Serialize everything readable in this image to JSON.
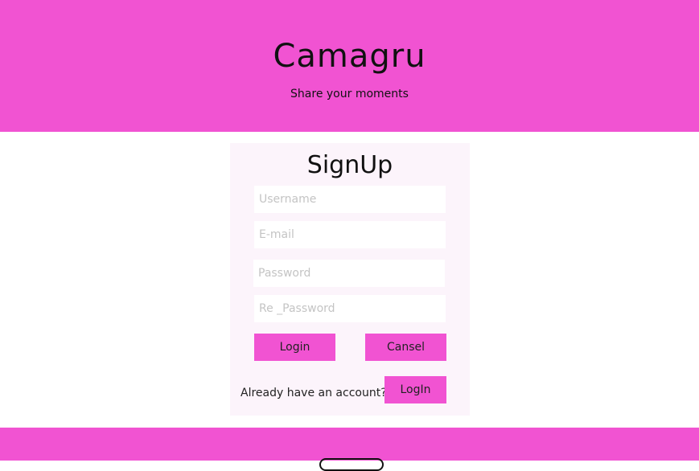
{
  "header": {
    "title": "Camagru",
    "tagline": "Share your moments"
  },
  "signup": {
    "heading": "SignUp",
    "username_placeholder": "Username",
    "email_placeholder": "E-mail",
    "password_placeholder": "Password",
    "repassword_placeholder": "Re _Password",
    "login_button": "Login",
    "cancel_button": "Cansel",
    "account_prompt": "Already have an account?",
    "login_link_button": "LogIn"
  },
  "colors": {
    "brand_pink": "#f153d2",
    "card_background": "#fcf4fb"
  }
}
